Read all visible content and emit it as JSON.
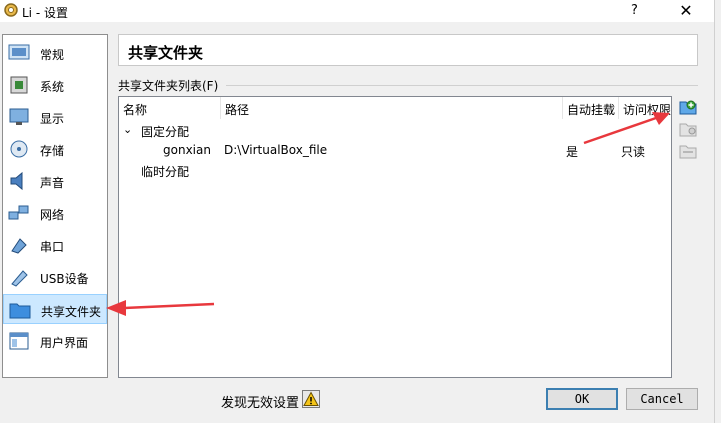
{
  "window": {
    "title": "Li - 设置",
    "help": "?",
    "close": "✕"
  },
  "sidebar": {
    "items": [
      {
        "label": "常规",
        "icon": "general-icon"
      },
      {
        "label": "系统",
        "icon": "system-icon"
      },
      {
        "label": "显示",
        "icon": "display-icon"
      },
      {
        "label": "存储",
        "icon": "storage-icon"
      },
      {
        "label": "声音",
        "icon": "audio-icon"
      },
      {
        "label": "网络",
        "icon": "network-icon"
      },
      {
        "label": "串口",
        "icon": "serial-port-icon"
      },
      {
        "label": "USB设备",
        "icon": "usb-icon"
      },
      {
        "label": "共享文件夹",
        "icon": "shared-folder-icon",
        "selected": true
      },
      {
        "label": "用户界面",
        "icon": "user-interface-icon"
      }
    ]
  },
  "main": {
    "header": "共享文件夹",
    "group_label": "共享文件夹列表(F)",
    "table": {
      "columns": [
        "名称",
        "路径",
        "自动挂载",
        "访问权限"
      ],
      "rows": [
        {
          "name": "固定分配",
          "expanded_marker": "⌄",
          "type": "group"
        },
        {
          "name": "gonxian",
          "path": "D:\\VirtualBox_file",
          "automount": "是",
          "access": "只读",
          "type": "item"
        },
        {
          "name": "临时分配",
          "type": "group"
        }
      ]
    }
  },
  "footer": {
    "invalid_settings": "发现无效设置",
    "ok": "OK",
    "cancel": "Cancel"
  },
  "colors": {
    "selection": "#cce8ff",
    "arrow": "#e8383d",
    "ok_border": "#3c7fb1"
  }
}
